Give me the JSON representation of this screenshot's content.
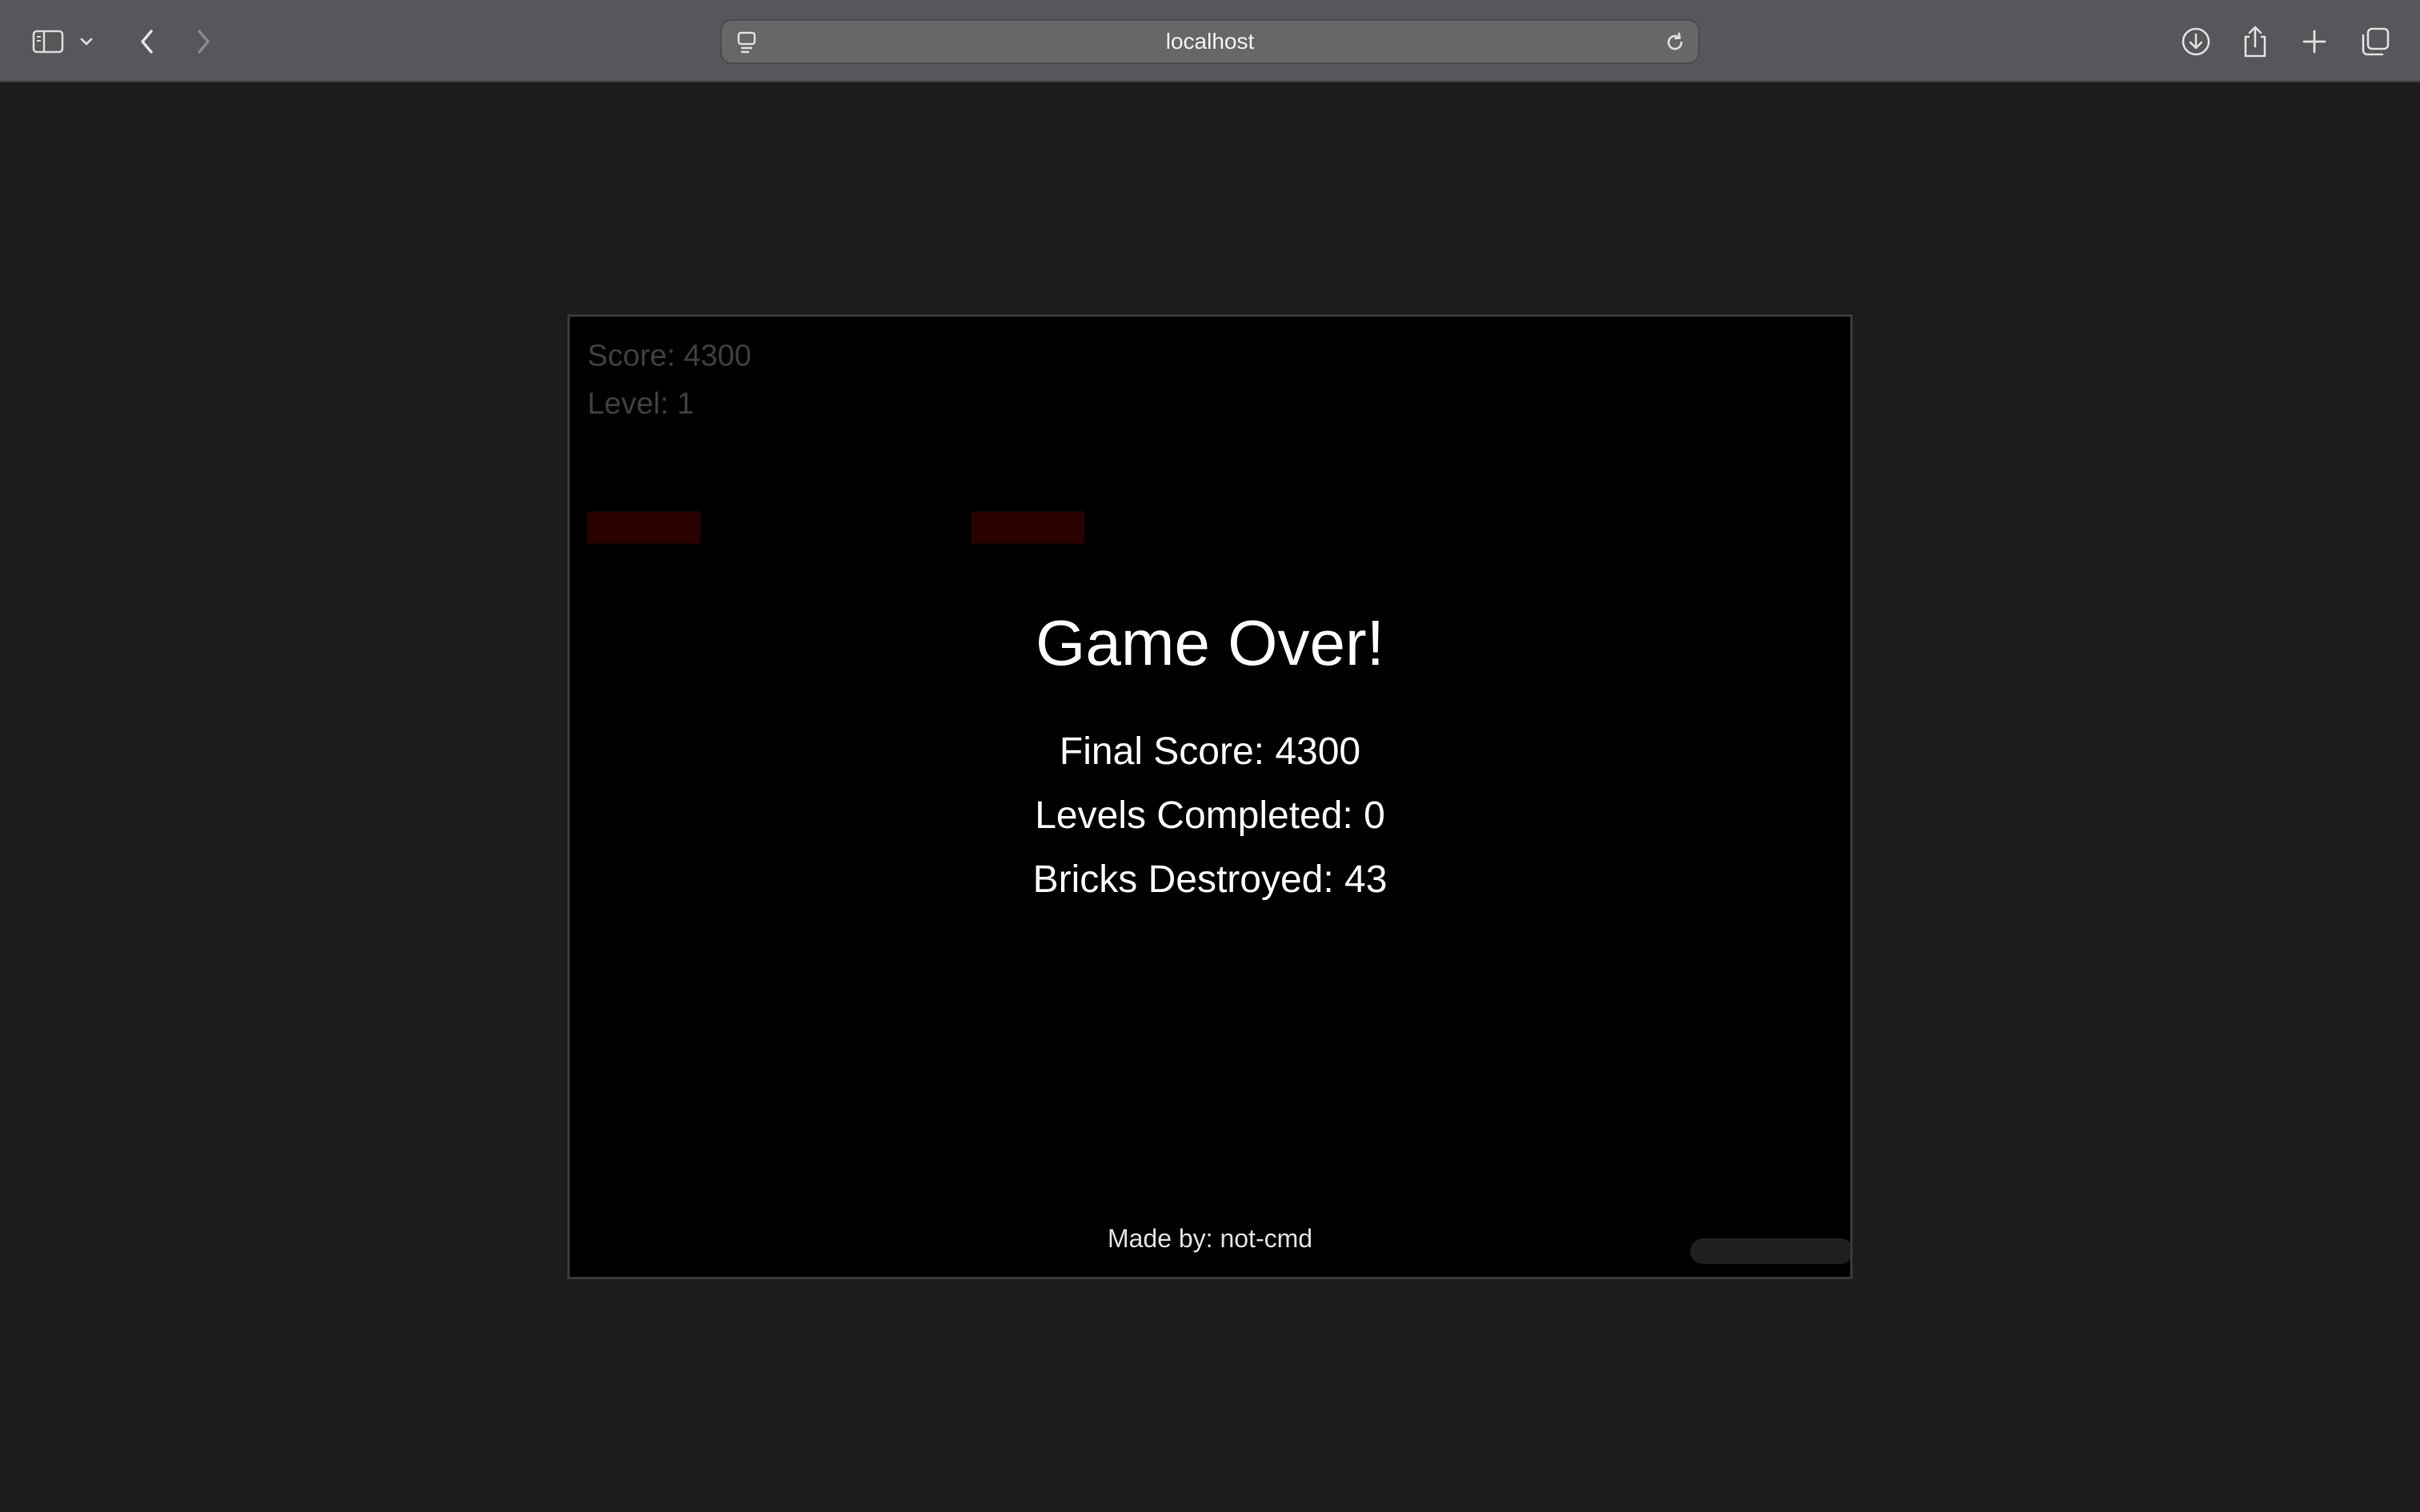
{
  "browser": {
    "url": "localhost",
    "icons": {
      "sidebar": "sidebar-icon",
      "sidebar_menu": "chevron-down-icon",
      "back": "chevron-left-icon",
      "forward": "chevron-right-icon",
      "page_menu": "page-menu-icon",
      "reload": "reload-icon",
      "download": "download-icon",
      "share": "share-icon",
      "new_tab": "plus-icon",
      "tab_overview": "tabs-icon"
    }
  },
  "game": {
    "hud": {
      "score": "Score: 4300",
      "level": "Level: 1"
    },
    "game_over": {
      "title": "Game Over!",
      "final_score": "Final Score: 4300",
      "levels_completed": "Levels Completed: 0",
      "bricks_destroyed": "Bricks Destroyed: 43"
    },
    "credit": "Made by: not-cmd",
    "colors": {
      "brick": "#2a0000",
      "paddle": "#1f1f1f",
      "background": "#000000"
    }
  }
}
